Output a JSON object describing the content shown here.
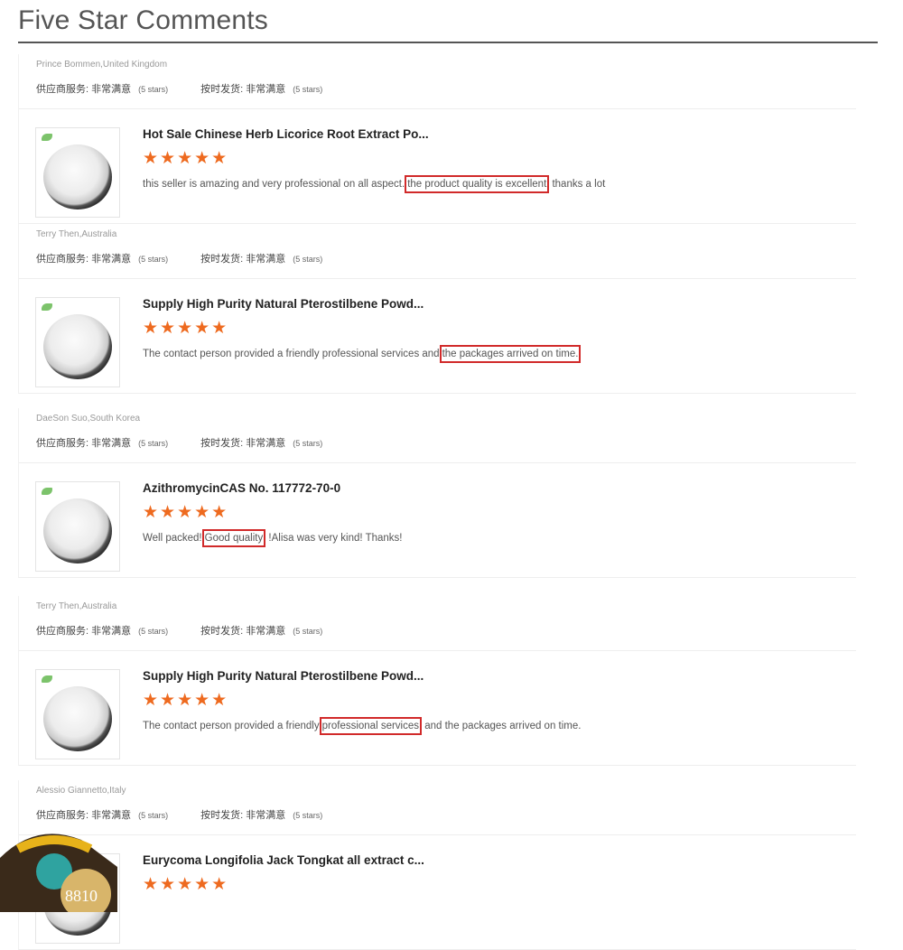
{
  "page": {
    "title": "Five Star Comments"
  },
  "colors": {
    "stars": "#ee6a1f",
    "highlight": "#d12a2a",
    "title_rule": "#555555"
  },
  "icons": {
    "star": "star-icon",
    "badge": "leaf-badge-icon"
  },
  "reviews": [
    {
      "reviewer": "Prince Bommen,United Kingdom",
      "ratings": [
        {
          "label": "供应商服务:",
          "value": "非常满意",
          "note": "(5 stars)"
        },
        {
          "label": "按时发货:",
          "value": "非常满意",
          "note": "(5 stars)"
        }
      ],
      "product": "Hot Sale Chinese Herb Licorice Root Extract Po...",
      "stars": 5,
      "comment_before": "this seller is amazing and very professional on all aspect.",
      "comment_highlight": "the product quality is excellent",
      "comment_after": "thanks a lot"
    },
    {
      "reviewer": "Terry Then,Australia",
      "ratings": [
        {
          "label": "供应商服务:",
          "value": "非常满意",
          "note": "(5 stars)"
        },
        {
          "label": "按时发货:",
          "value": "非常满意",
          "note": "(5 stars)"
        }
      ],
      "product": "Supply High Purity Natural Pterostilbene Powd...",
      "stars": 5,
      "comment_before": "The contact person provided a friendly professional services and",
      "comment_highlight": "the packages arrived on time.",
      "comment_after": ""
    },
    {
      "reviewer": "DaeSon Suo,South Korea",
      "ratings": [
        {
          "label": "供应商服务:",
          "value": "非常满意",
          "note": "(5 stars)"
        },
        {
          "label": "按时发货:",
          "value": "非常满意",
          "note": "(5 stars)"
        }
      ],
      "product": "AzithromycinCAS No. 117772-70-0",
      "stars": 5,
      "comment_before": "Well packed!",
      "comment_highlight": "Good quality",
      "comment_after": "!Alisa was very kind! Thanks!"
    },
    {
      "reviewer": "Terry Then,Australia",
      "ratings": [
        {
          "label": "供应商服务:",
          "value": "非常满意",
          "note": "(5 stars)"
        },
        {
          "label": "按时发货:",
          "value": "非常满意",
          "note": "(5 stars)"
        }
      ],
      "product": "Supply High Purity Natural Pterostilbene Powd...",
      "stars": 5,
      "comment_before": "The contact person provided a friendly",
      "comment_highlight": "professional services",
      "comment_after": "and the packages arrived on time."
    },
    {
      "reviewer": "Alessio Giannetto,Italy",
      "ratings": [
        {
          "label": "供应商服务:",
          "value": "非常满意",
          "note": "(5 stars)"
        },
        {
          "label": "按时发货:",
          "value": "非常满意",
          "note": "(5 stars)"
        }
      ],
      "product": "Eurycoma Longifolia Jack Tongkat all extract c...",
      "stars": 5,
      "comment_before": "",
      "comment_highlight": "",
      "comment_after": ""
    }
  ],
  "decor": {
    "watermark": "8810"
  }
}
